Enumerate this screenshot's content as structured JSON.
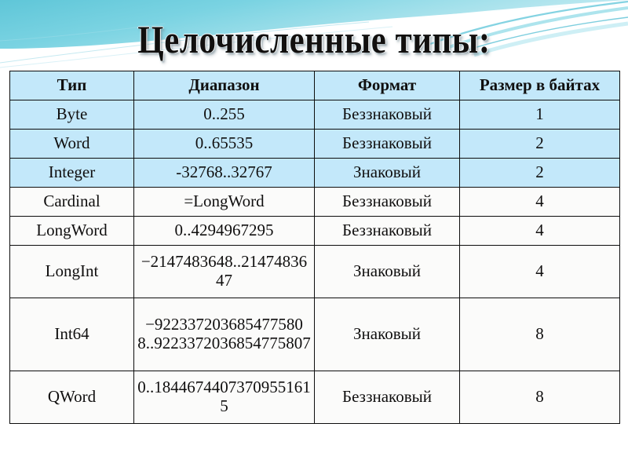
{
  "slide": {
    "title": "Целочисленные типы:",
    "accent_color": "#6fd0e0",
    "table_row_blue": "#c3e8fa",
    "table_row_plain": "#fbfbfa",
    "border_color": "#0d0d0d"
  },
  "table": {
    "headers": [
      "Тип",
      "Диапазон",
      "Формат",
      "Размер в байтах"
    ],
    "rows": [
      {
        "type": "Byte",
        "range": "0..255",
        "format": "Беззнаковый",
        "size": "1",
        "shade": "blue",
        "height": "h-1"
      },
      {
        "type": "Word",
        "range": "0..65535",
        "format": "Беззнаковый",
        "size": "2",
        "shade": "blue",
        "height": "h-1"
      },
      {
        "type": "Integer",
        "range": "-32768..32767",
        "format": "Знаковый",
        "size": "2",
        "shade": "blue",
        "height": "h-1"
      },
      {
        "type": "Cardinal",
        "range": "=LongWord",
        "format": "Беззнаковый",
        "size": "4",
        "shade": "plain",
        "height": "h-1"
      },
      {
        "type": "LongWord",
        "range": "0..4294967295",
        "format": "Беззнаковый",
        "size": "4",
        "shade": "plain",
        "height": "h-1"
      },
      {
        "type": "LongInt",
        "range": "−2147483648..2147483647",
        "format": "Знаковый",
        "size": "4",
        "shade": "plain",
        "height": "h-2"
      },
      {
        "type": "Int64",
        "range": "−9223372036854775808..9223372036854775807",
        "format": "Знаковый",
        "size": "8",
        "shade": "plain",
        "height": "h-3"
      },
      {
        "type": "QWord",
        "range": "0..18446744073709551615",
        "format": "Беззнаковый",
        "size": "8",
        "shade": "plain",
        "height": "h-2"
      }
    ]
  }
}
